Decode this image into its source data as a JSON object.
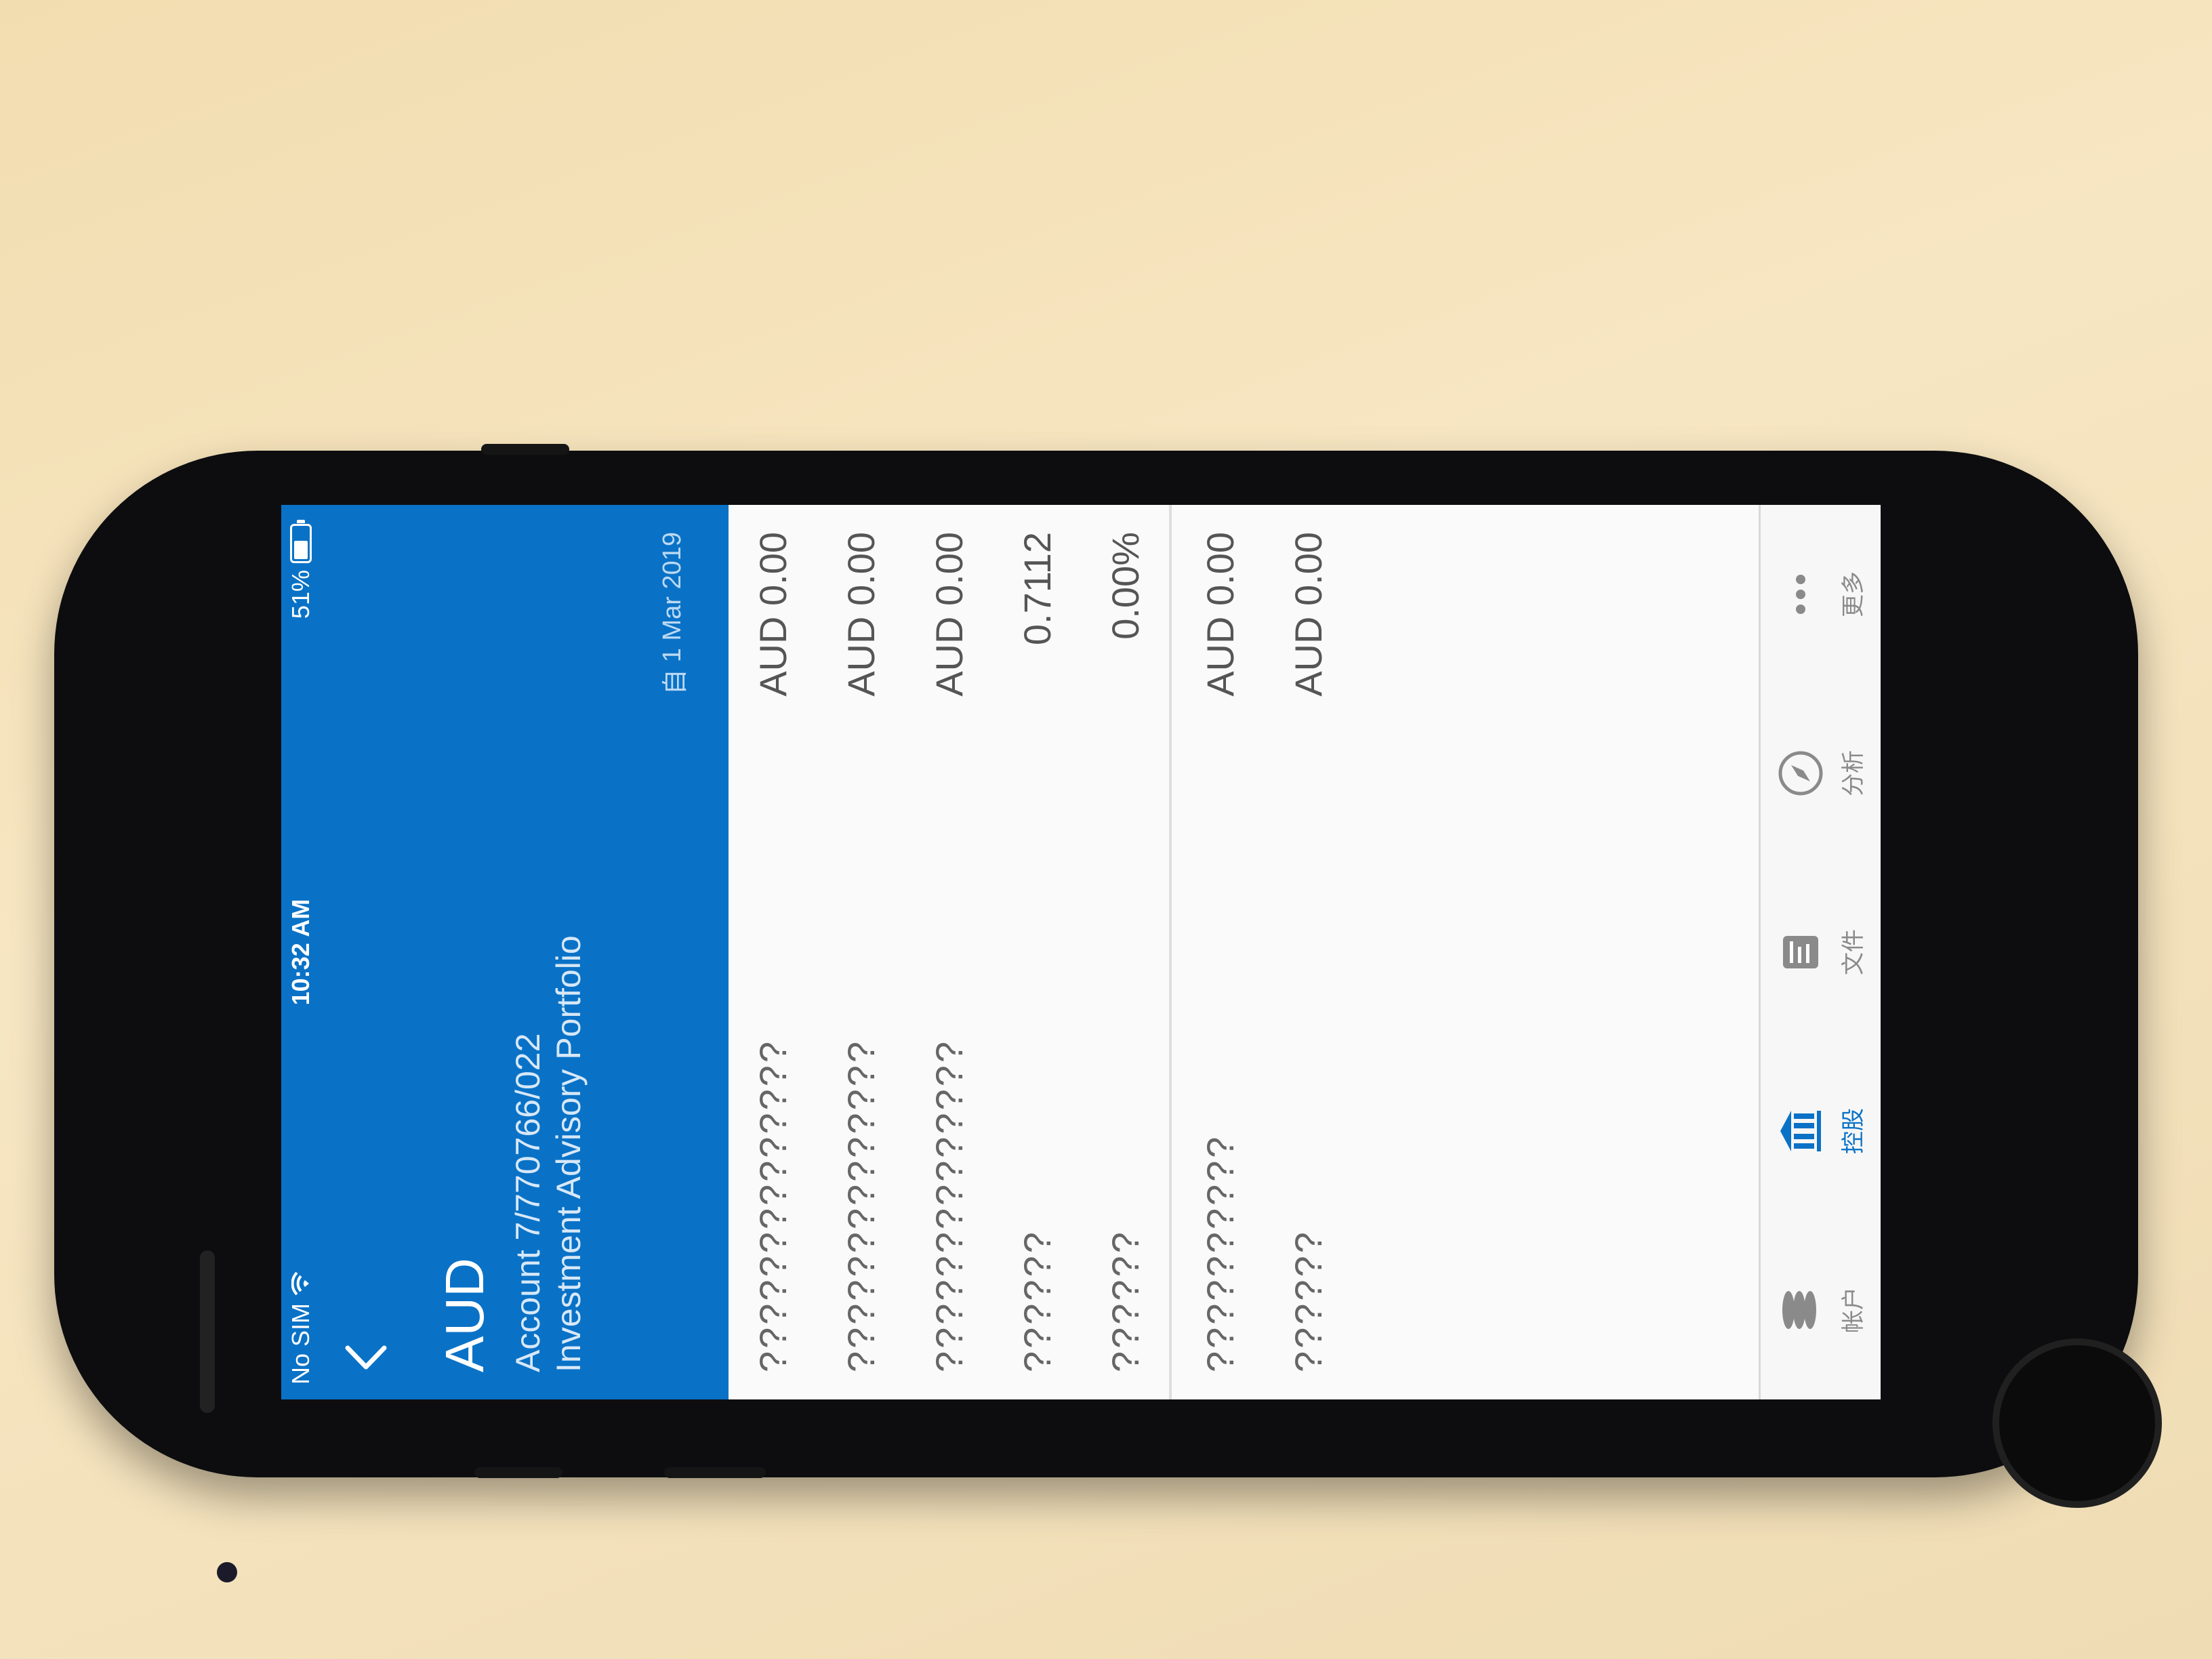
{
  "status_bar": {
    "carrier": "No SIM",
    "time": "10:32 AM",
    "battery": "51%",
    "battery_level": 0.51
  },
  "header": {
    "title": "AUD",
    "account": "Account 7/770766/022",
    "portfolio": "Investment Advisory Portfolio",
    "date_prefix": "自",
    "date": "1 Mar 2019"
  },
  "rows": [
    {
      "label": "??????????????",
      "value": "AUD 0.00"
    },
    {
      "label": "??????????????",
      "value": "AUD 0.00"
    },
    {
      "label": "??????????????",
      "value": "AUD 0.00"
    },
    {
      "label": "??????",
      "value": "0.7112"
    },
    {
      "label": "??????",
      "value": "0.00%"
    },
    {
      "label": "??????????",
      "value": "AUD 0.00"
    },
    {
      "label": "??????",
      "value": "AUD 0.00"
    }
  ],
  "tabs": [
    {
      "label": "帐户",
      "icon": "stack-icon"
    },
    {
      "label": "控股",
      "icon": "bank-icon",
      "active": true
    },
    {
      "label": "文件",
      "icon": "document-icon"
    },
    {
      "label": "分析",
      "icon": "compass-icon"
    },
    {
      "label": "更多",
      "icon": "more-icon"
    }
  ],
  "colors": {
    "header_blue": "#0a72c6",
    "active_tab": "#0a72c6",
    "inactive_tab": "#8a8a8a"
  }
}
